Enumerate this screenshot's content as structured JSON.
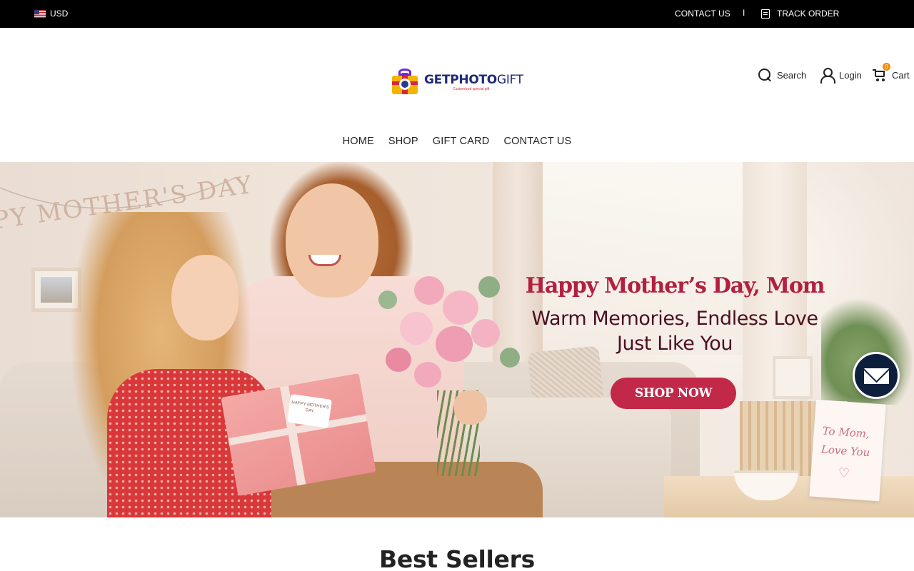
{
  "topbar": {
    "currency": "USD",
    "contact": "CONTACT US",
    "separator": "I",
    "track_order": "TRACK ORDER"
  },
  "header": {
    "logo": {
      "name_bold": "GETPHOTO",
      "name_light": "GIFT",
      "tagline": "Customized special gift"
    },
    "search_label": "Search",
    "login_label": "Login",
    "cart_label": "Cart",
    "cart_count": "0"
  },
  "nav": {
    "items": [
      "HOME",
      "SHOP",
      "GIFT CARD",
      "CONTACT US"
    ]
  },
  "hero": {
    "banner_text": "PY MOTHER'S DAY",
    "gift_tag": "HAPPY MOTHER'S DAY",
    "card_line1": "To Mom,",
    "card_line2": "Love You",
    "title": "Happy Mother’s Day, Mom",
    "subtitle_line1": "Warm Memories, Endless Love",
    "subtitle_line2": "Just Like You",
    "cta": "SHOP NOW",
    "colors": {
      "title": "#b3203f",
      "subtitle": "#4a1020",
      "cta_background": "#c22847"
    }
  },
  "chat": {
    "icon": "envelope-icon"
  },
  "section": {
    "best_sellers": "Best Sellers"
  }
}
